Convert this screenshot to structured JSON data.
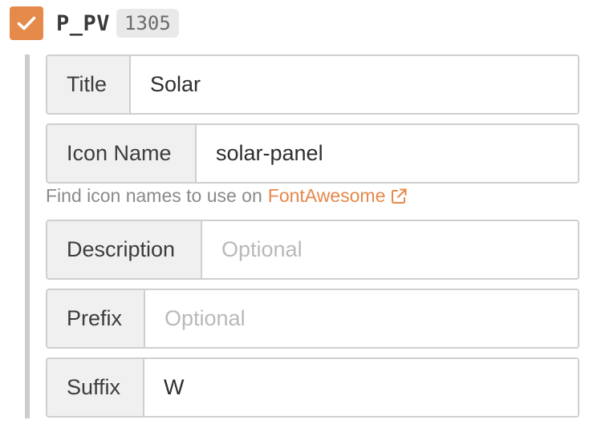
{
  "header": {
    "checked": true,
    "variable_name": "P_PV",
    "count": "1305",
    "checkbox_color": "#e58a4a"
  },
  "fields": {
    "title": {
      "label": "Title",
      "value": "Solar",
      "placeholder": ""
    },
    "icon_name": {
      "label": "Icon Name",
      "value": "solar-panel",
      "placeholder": ""
    },
    "description": {
      "label": "Description",
      "value": "",
      "placeholder": "Optional"
    },
    "prefix": {
      "label": "Prefix",
      "value": "",
      "placeholder": "Optional"
    },
    "suffix": {
      "label": "Suffix",
      "value": "W",
      "placeholder": ""
    }
  },
  "hint": {
    "text": "Find icon names to use on",
    "link_label": "FontAwesome",
    "link_color": "#e5884a",
    "link_icon": "external-link-icon"
  }
}
